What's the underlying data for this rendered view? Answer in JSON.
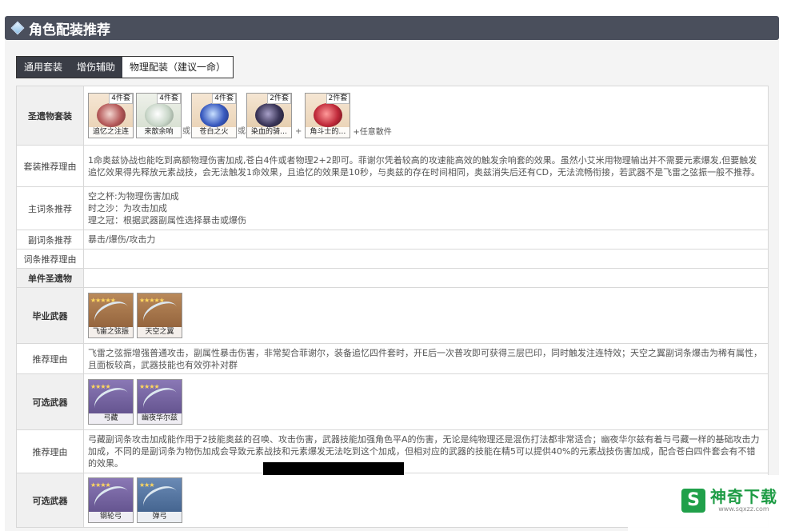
{
  "section": {
    "title": "角色配装推荐"
  },
  "tabs": [
    {
      "label": "通用套装"
    },
    {
      "label": "增伤辅助"
    },
    {
      "label": "物理配装（建议一命）"
    }
  ],
  "rows": {
    "artifact_set": {
      "label": "圣遗物套装",
      "sets": [
        {
          "name": "追忆之注连",
          "pieces": "4件套",
          "icon": "artifact-shimenawa-icon"
        },
        {
          "name": "来歆余响",
          "pieces": "4件套",
          "icon": "artifact-echoes-icon"
        },
        {
          "name": "苍白之火",
          "pieces": "4件套",
          "icon": "artifact-pale-flame-icon"
        },
        {
          "name": "染血的骑…",
          "pieces": "2件套",
          "icon": "artifact-bloodstained-icon"
        },
        {
          "name": "角斗士的…",
          "pieces": "2件套",
          "icon": "artifact-gladiator-icon"
        }
      ],
      "or1": "或",
      "or2": "或",
      "plus": "+",
      "suffix": "+任意散件"
    },
    "set_reason": {
      "label": "套装推荐理由",
      "text": "1命奥兹协战也能吃到高额物理伤害加成,苍白4件或者物理2+2即可。菲谢尔凭着较高的攻速能高效的触发余响套的效果。虽然小艾米用物理输出并不需要元素爆发,但要触发追忆效果得先释放元素战技，会无法触发1命效果，且追忆的效果是10秒，与奥兹的存在时间相同，奥兹消失后还有CD，无法流畅衔接，若武器不是飞雷之弦振一般不推荐。"
    },
    "main_stat": {
      "label": "主词条推荐",
      "lines": [
        "空之杯:为物理伤害加成",
        "时之沙：为攻击加成",
        "理之冠：根据武器副属性选择暴击或爆伤"
      ]
    },
    "sub_stat": {
      "label": "副词条推荐",
      "text": "暴击/爆伤/攻击力"
    },
    "stat_reason": {
      "label": "词条推荐理由",
      "text": ""
    },
    "single_artifact": {
      "label": "单件圣遗物",
      "text": ""
    },
    "bis_weapon": {
      "label": "毕业武器",
      "weapons": [
        {
          "name": "飞雷之弦振",
          "stars": "★★★★★",
          "icon": "bow-polar-star-icon"
        },
        {
          "name": "天空之翼",
          "stars": "★★★★★",
          "icon": "bow-skyward-harp-icon"
        }
      ]
    },
    "bis_reason": {
      "label": "推荐理由",
      "text": "飞雷之弦振增强普通攻击，副属性暴击伤害，非常契合菲谢尔，装备追忆四件套时，开E后一次普攻即可获得三层巴印，同时触发注连特效；天空之翼副词条爆击为稀有属性，且面板较高，武器技能也有效弥补对群"
    },
    "alt_weapon_1": {
      "label": "可选武器",
      "weapons": [
        {
          "name": "弓藏",
          "stars": "★★★★",
          "icon": "bow-rust-icon"
        },
        {
          "name": "幽夜华尔兹",
          "stars": "★★★★",
          "icon": "bow-alley-hunter-icon"
        }
      ]
    },
    "alt_reason": {
      "label": "推荐理由",
      "text": "弓藏副词条攻击加成能作用于2技能奥兹的召唤、攻击伤害，武器技能加强角色平A的伤害，无论是纯物理还是混伤打法都非常适合；幽夜华尔兹有着与弓藏一样的基础攻击力加成，不同的是副词条为物伤加成会导致元素战技和元素爆发无法吃到这个加成，但相对应的武器的技能在精5可以提供40%的元素战技伤害加成，配合苍白四件套会有不错的效果。"
    },
    "alt_weapon_2": {
      "label": "可选武器",
      "weapons": [
        {
          "name": "钢轮弓",
          "stars": "★★★★",
          "icon": "bow-compound-icon"
        },
        {
          "name": "弹弓",
          "stars": "★★★",
          "icon": "bow-slingshot-icon"
        }
      ]
    }
  },
  "watermark": {
    "brand": "神奇下载",
    "url": "www.sqxzz.com",
    "icon": "sqxz-logo-icon"
  },
  "colors": {
    "header_bg": "#4a4f5c",
    "tab_bg": "#3a3d46",
    "watermark_green": "#1e9c45"
  }
}
